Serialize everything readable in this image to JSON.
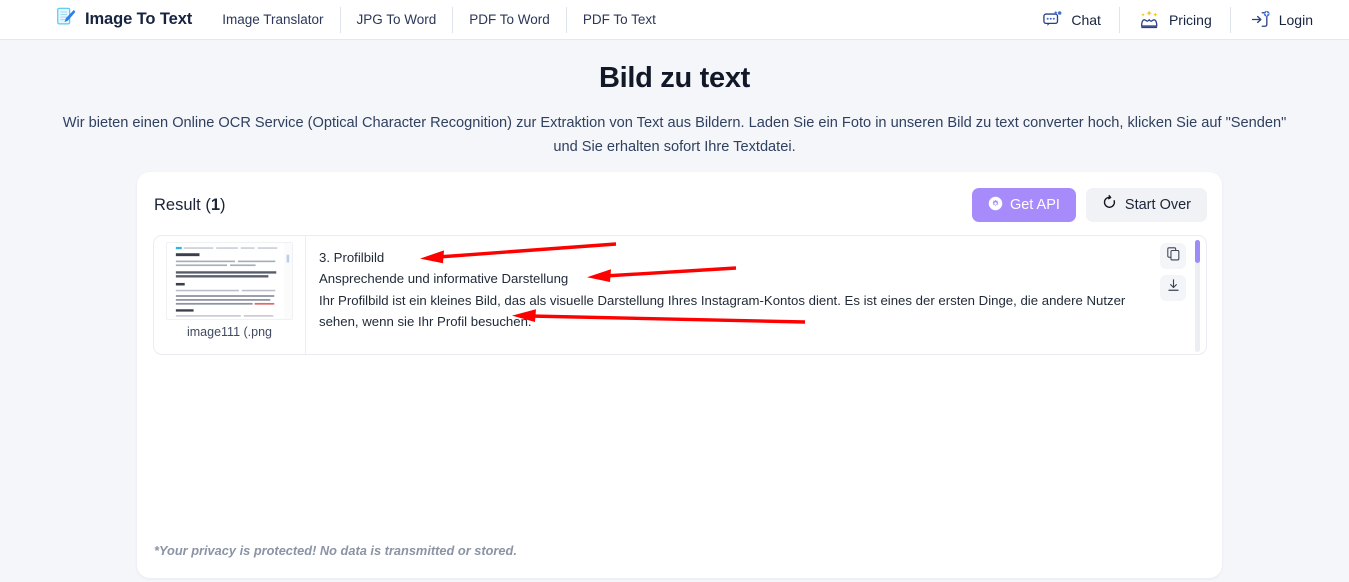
{
  "navbar": {
    "brand": {
      "label": "Image To Text",
      "icon": "document-pen-icon"
    },
    "items": [
      {
        "label": "Image Translator"
      },
      {
        "label": "JPG To Word"
      },
      {
        "label": "PDF To Word"
      },
      {
        "label": "PDF To Text"
      }
    ],
    "actions": [
      {
        "label": "Chat",
        "icon": "chat-bubble-icon"
      },
      {
        "label": "Pricing",
        "icon": "crown-icon"
      },
      {
        "label": "Login",
        "icon": "login-arrow-icon"
      }
    ]
  },
  "hero": {
    "title": "Bild zu text",
    "description": "Wir bieten einen Online OCR Service (Optical Character Recognition) zur Extraktion von Text aus Bildern. Laden Sie ein Foto in unseren Bild zu text converter hoch, klicken Sie auf \"Senden\" und Sie erhalten sofort Ihre Textdatei."
  },
  "card": {
    "result_label": "Result (",
    "result_count": "1",
    "result_label_end": ")",
    "buttons": {
      "get_api": "Get API",
      "start_over": "Start Over"
    },
    "file": {
      "name": "image111 (.png"
    },
    "ocr_text": {
      "line1": "3. Profilbild",
      "line2": "Ansprechende und informative Darstellung",
      "line3": "Ihr Profilbild ist ein kleines Bild, das als visuelle Darstellung Ihres Instagram-Kontos dient. Es ist eines der ersten Dinge, die andere Nutzer sehen, wenn sie Ihr Profil besuchen."
    },
    "tools": [
      {
        "name": "copy-icon"
      },
      {
        "name": "download-icon"
      }
    ],
    "privacy_note": "*Your privacy is protected! No data is transmitted or stored."
  },
  "colors": {
    "accent_purple": "#a78bfa",
    "page_bg": "#f4f6fa",
    "annotation_red": "#ff0000",
    "brand_blue": "#2f6fe4"
  }
}
